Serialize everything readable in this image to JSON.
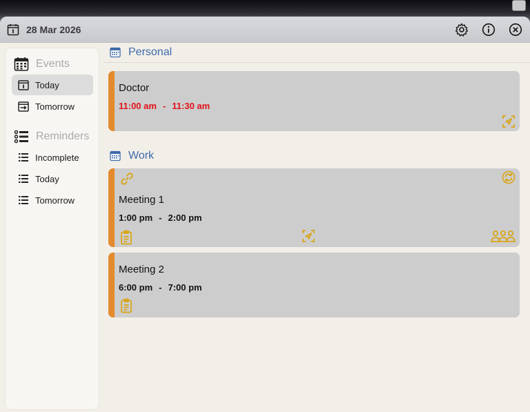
{
  "titlebar": {
    "date": "28 Mar 2026",
    "icons": [
      "calendar-day-icon",
      "gear-icon",
      "info-icon",
      "close-icon"
    ]
  },
  "sidebar": {
    "events_label": "Events",
    "events": [
      {
        "label": "Today",
        "icon": "calendar-today-icon",
        "active": true
      },
      {
        "label": "Tomorrow",
        "icon": "calendar-tomorrow-icon",
        "active": false
      }
    ],
    "reminders_label": "Reminders",
    "reminders": [
      {
        "label": "Incomplete",
        "icon": "list-icon"
      },
      {
        "label": "Today",
        "icon": "list-icon"
      },
      {
        "label": "Tomorrow",
        "icon": "list-icon"
      }
    ]
  },
  "groups": [
    {
      "name": "Personal",
      "events": [
        {
          "title": "Doctor",
          "start": "11:00 am",
          "end": "11:30 am",
          "time_color": "#e0121a"
        }
      ]
    },
    {
      "name": "Work",
      "events": [
        {
          "title": "Meeting 1",
          "start": "1:00 pm",
          "end": "2:00 pm",
          "icons": [
            "link-icon",
            "recurring-icon",
            "notes-icon",
            "location-icon",
            "attendees-icon"
          ]
        },
        {
          "title": "Meeting 2",
          "start": "6:00 pm",
          "end": "7:00 pm",
          "icons": [
            "notes-icon"
          ]
        }
      ]
    }
  ],
  "colors": {
    "accent_stripe": "#e38a2c",
    "group_title": "#3e6aa8",
    "icon_gold": "#d9a412",
    "overdue_time": "#e0121a"
  },
  "time_separator": "-"
}
